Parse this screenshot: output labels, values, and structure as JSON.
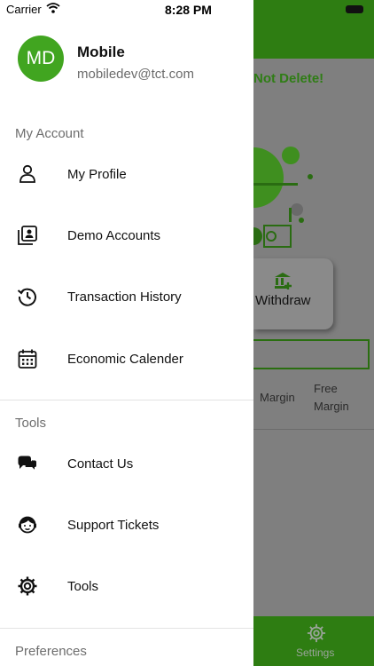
{
  "status_bar": {
    "carrier": "Carrier",
    "time": "8:28 PM"
  },
  "profile": {
    "initials": "MD",
    "name": "Mobile",
    "email": "mobiledev@tct.com"
  },
  "sections": {
    "account": "My Account",
    "tools": "Tools",
    "preferences": "Preferences"
  },
  "menu": {
    "account": [
      {
        "label": "My Profile",
        "icon": "person-icon"
      },
      {
        "label": "Demo Accounts",
        "icon": "accounts-icon"
      },
      {
        "label": "Transaction History",
        "icon": "history-icon"
      },
      {
        "label": "Economic Calender",
        "icon": "calendar-icon"
      }
    ],
    "tools": [
      {
        "label": "Contact Us",
        "icon": "chat-icon"
      },
      {
        "label": "Support Tickets",
        "icon": "support-icon"
      },
      {
        "label": "Tools",
        "icon": "gear-icon"
      }
    ]
  },
  "background": {
    "warning": "Not Delete!",
    "withdraw": "Withdraw",
    "columns": [
      "Margin",
      "Free",
      "Margin"
    ],
    "tab_settings": "Settings"
  },
  "colors": {
    "brand": "#41a520",
    "header": "#2e7d12"
  }
}
